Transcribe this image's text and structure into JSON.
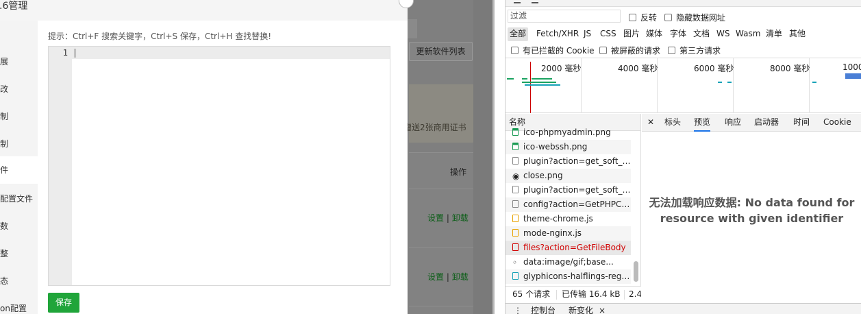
{
  "modal": {
    "title": ".6管理",
    "sidebar": [
      "展",
      "改",
      "制",
      "制",
      "件",
      "配置文件",
      "数",
      "整",
      "态",
      "on配置"
    ],
    "active_index": 4,
    "hint": "提示：Ctrl+F 搜索关键字，Ctrl+S 保存，Ctrl+H 查找替换!",
    "editor": {
      "line_number": "1",
      "content": ""
    },
    "save_label": "保存"
  },
  "background": {
    "update_button": "更新软件列表",
    "notice_text": "赠送2张商用证书",
    "table_header": "操作",
    "rows": [
      {
        "settings": "设置",
        "separator": "|",
        "uninstall": "卸载"
      },
      {
        "settings": "设置",
        "separator": "|",
        "uninstall": "卸载"
      }
    ]
  },
  "devtools": {
    "filter_placeholder": "过滤",
    "invert_label": "反转",
    "hide_data_urls_label": "隐藏数据网址",
    "type_filters": [
      "全部",
      "Fetch/XHR",
      "JS",
      "CSS",
      "图片",
      "媒体",
      "字体",
      "文档",
      "WS",
      "Wasm",
      "清单",
      "其他"
    ],
    "blocked_cookies_label": "有已拦截的 Cookie",
    "blocked_requests_label": "被屏蔽的请求",
    "third_party_label": "第三方请求",
    "timeline_ticks": [
      "2000 毫秒",
      "4000 毫秒",
      "6000 毫秒",
      "8000 毫秒",
      "1000"
    ],
    "name_header": "名称",
    "requests": [
      {
        "name": "ico-phpmyadmin.png",
        "icon": "image-icon"
      },
      {
        "name": "ico-webssh.png",
        "icon": "image-icon"
      },
      {
        "name": "plugin?action=get_soft_find",
        "icon": "document-icon"
      },
      {
        "name": "close.png",
        "icon": "image-icon"
      },
      {
        "name": "plugin?action=get_soft_find",
        "icon": "document-icon"
      },
      {
        "name": "config?action=GetPHPConf",
        "icon": "document-icon"
      },
      {
        "name": "theme-chrome.js",
        "icon": "script-icon"
      },
      {
        "name": "mode-nginx.js",
        "icon": "script-icon"
      },
      {
        "name": "files?action=GetFileBody",
        "icon": "document-icon",
        "selected": true
      },
      {
        "name": "data:image/gif;base...",
        "icon": "dot-icon"
      },
      {
        "name": "glyphicons-halflings-regular...",
        "icon": "font-icon"
      }
    ],
    "detail_tabs": [
      "标头",
      "预览",
      "响应",
      "启动器",
      "时间",
      "Cookie"
    ],
    "active_tab": "预览",
    "no_data_message": "无法加载响应数据: No data found for resource with given identifier",
    "status": {
      "requests": "65 个请求",
      "transferred": "已传输 16.4 kB",
      "extra": "2.4"
    },
    "drawer_tabs": [
      "控制台",
      "新变化"
    ]
  }
}
